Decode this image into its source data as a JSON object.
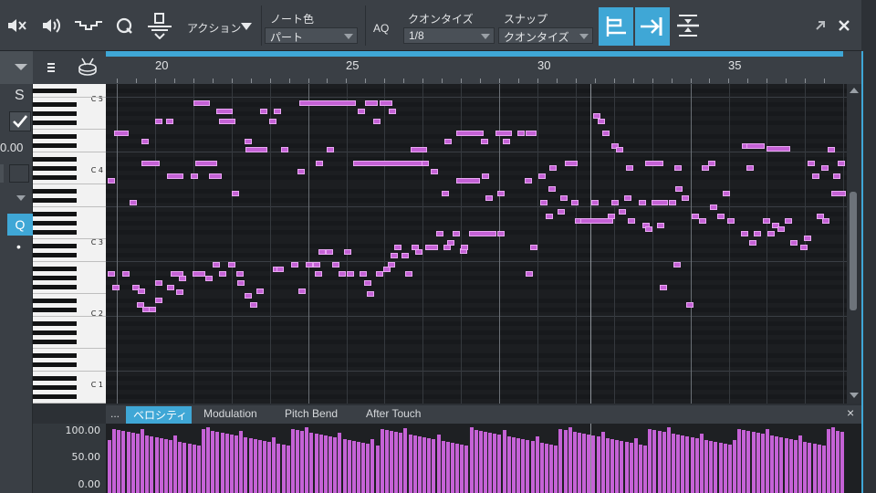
{
  "toolbar": {
    "icons": [
      "speaker-mute-icon",
      "speaker-icon",
      "velocity-curve-icon",
      "quantize-q-icon",
      "paint-tool-icon"
    ],
    "action_label": "アクション",
    "note_color_label": "ノート色",
    "note_color_value": "パート",
    "aq_label": "AQ",
    "quantize_label": "クオンタイズ",
    "quantize_value": "1/8",
    "snap_label": "スナップ",
    "snap_value": "クオンタイズ",
    "window_icons": [
      "expand-icon",
      "close-icon"
    ]
  },
  "left_panel": {
    "s_label": "S",
    "value_label": "0.00",
    "q_label": "Q",
    "dot_label": "•"
  },
  "ruler": {
    "bars": [
      "20",
      "25",
      "30",
      "35"
    ]
  },
  "piano": {
    "octave_labels": [
      "C 5",
      "C 4",
      "C 3",
      "C 2",
      "C 1"
    ]
  },
  "tabs": {
    "more_label": "...",
    "items": [
      "ベロシティ",
      "Modulation",
      "Pitch Bend",
      "After Touch"
    ],
    "active_index": 0,
    "close_label": "×"
  },
  "velocity": {
    "labels": [
      "100.00",
      "50.00",
      "0.00"
    ]
  },
  "colors": {
    "accent": "#3fa7d6",
    "note": "#c562d6",
    "note_border": "#e8a6f2",
    "grid_bg": "#1c1e21"
  }
}
